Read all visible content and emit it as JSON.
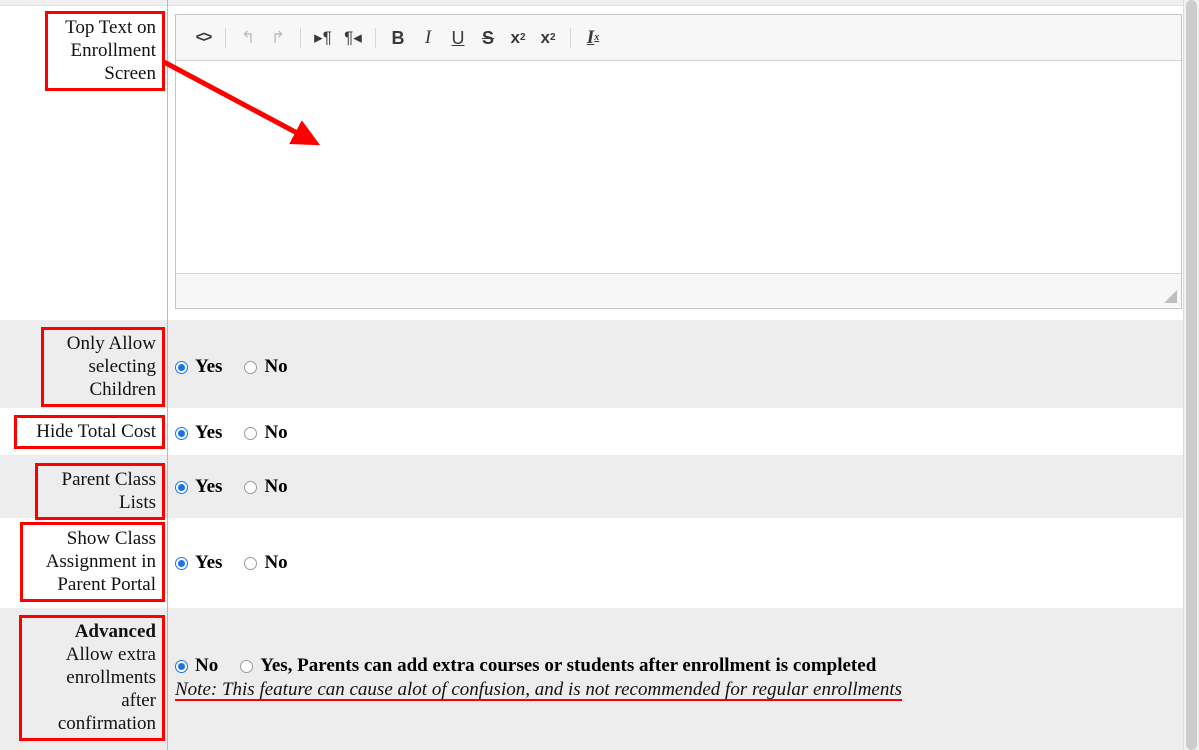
{
  "editor": {
    "toolbar_buttons": [
      {
        "name": "source-icon",
        "glyph": "<>",
        "label": "Source",
        "style": "src",
        "dim": false
      },
      {
        "name": "undo-icon",
        "glyph": "↰",
        "label": "Undo",
        "style": "arw",
        "dim": true
      },
      {
        "name": "redo-icon",
        "glyph": "↱",
        "label": "Redo",
        "style": "arw",
        "dim": true
      },
      {
        "name": "text-direction-ltr-icon",
        "glyph": "▸¶",
        "label": "Text direction from left to right",
        "style": "dir",
        "dim": false
      },
      {
        "name": "text-direction-rtl-icon",
        "glyph": "¶◂",
        "label": "Text direction from right to left",
        "style": "dir",
        "dim": false
      },
      {
        "name": "bold-icon",
        "glyph": "B",
        "label": "Bold",
        "style": "bold",
        "dim": false
      },
      {
        "name": "italic-icon",
        "glyph": "I",
        "label": "Italic",
        "style": "ital",
        "dim": false
      },
      {
        "name": "underline-icon",
        "glyph": "U",
        "label": "Underline",
        "style": "undr",
        "dim": false
      },
      {
        "name": "strikethrough-icon",
        "glyph": "S",
        "label": "Strikethrough",
        "style": "strk",
        "dim": false
      },
      {
        "name": "subscript-icon",
        "glyph": "x",
        "label": "Subscript",
        "style": "sub",
        "dim": false
      },
      {
        "name": "superscript-icon",
        "glyph": "x",
        "label": "Superscript",
        "style": "sup",
        "dim": false
      },
      {
        "name": "remove-format-icon",
        "glyph": "I",
        "label": "Remove Format",
        "style": "rmv",
        "dim": false
      }
    ],
    "content": "",
    "resize_grip_label": "Resize"
  },
  "rows": [
    {
      "key": "top_text",
      "label": "Top Text on Enrollment Screen",
      "label_lines": [
        "Top Text on",
        "Enrollment",
        "Screen"
      ],
      "control": "richtext"
    },
    {
      "key": "only_allow_selecting_children",
      "label": "Only Allow selecting Children",
      "label_lines": [
        "Only Allow",
        "selecting",
        "Children"
      ],
      "control": "yesno",
      "options": [
        "Yes",
        "No"
      ],
      "selected": "Yes"
    },
    {
      "key": "hide_total_cost",
      "label": "Hide Total Cost",
      "label_lines": [
        "Hide Total Cost"
      ],
      "control": "yesno",
      "options": [
        "Yes",
        "No"
      ],
      "selected": "Yes"
    },
    {
      "key": "parent_class_lists",
      "label": "Parent Class Lists",
      "label_lines": [
        "Parent Class",
        "Lists"
      ],
      "control": "yesno",
      "options": [
        "Yes",
        "No"
      ],
      "selected": "Yes"
    },
    {
      "key": "show_class_assignment_in_parent_portal",
      "label": "Show Class Assignment in Parent Portal",
      "label_lines": [
        "Show Class",
        "Assignment in",
        "Parent Portal"
      ],
      "control": "yesno",
      "options": [
        "Yes",
        "No"
      ],
      "selected": "Yes"
    },
    {
      "key": "advanced_allow_extra_enrollments",
      "label": "Advanced Allow extra enrollments after confirmation",
      "label_heading": "Advanced",
      "label_lines": [
        "Allow extra",
        "enrollments",
        "after",
        "confirmation"
      ],
      "control": "advanced",
      "options": [
        "No",
        "Yes, Parents can add extra courses or students after enrollment is completed"
      ],
      "selected": "No",
      "note": "Note: This feature can cause alot of confusion, and is not recommended for regular enrollments"
    }
  ],
  "annotation": {
    "color": "#ff0000",
    "arrow_label": "pointer-to-editor-body"
  },
  "colors": {
    "row_gray": "#ededed",
    "row_white": "#ffffff",
    "radio_selected": "#1b73e8",
    "annotation_red": "#ff0000",
    "toolbar_bg": "#f7f7f7"
  }
}
